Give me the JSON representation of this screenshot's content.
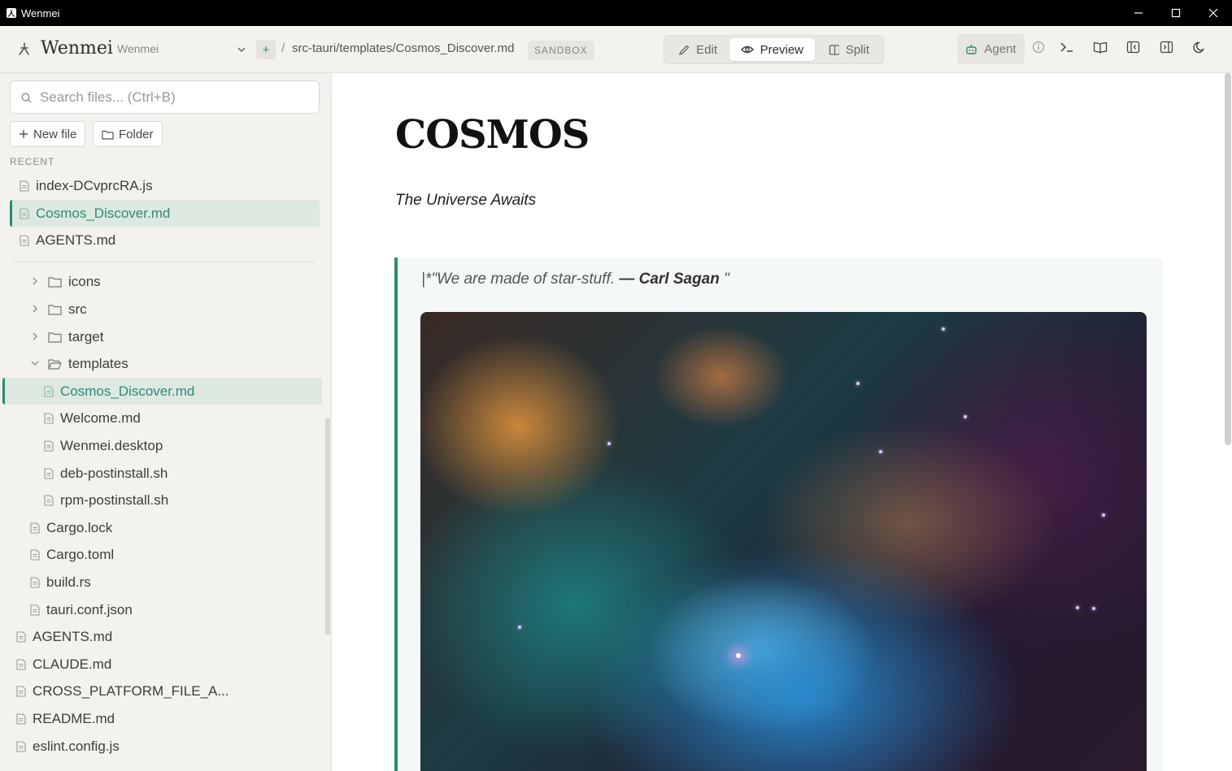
{
  "window": {
    "title": "Wenmei"
  },
  "appbar": {
    "brand": "Wenmei",
    "workspace": "Wenmei",
    "add_label": "+",
    "path_sep": "/",
    "path": "src-tauri/templates/Cosmos_Discover.md",
    "sandbox": "SANDBOX",
    "modes": [
      {
        "label": "Edit"
      },
      {
        "label": "Preview"
      },
      {
        "label": "Split"
      }
    ],
    "active_mode": "Preview",
    "agent": "Agent"
  },
  "sidebar": {
    "search_placeholder": "Search files... (Ctrl+B)",
    "new_file": "New file",
    "folder": "Folder",
    "recent_label": "RECENT",
    "recent": [
      "index-DCvprcRA.js",
      "Cosmos_Discover.md",
      "AGENTS.md"
    ],
    "tree": [
      "icons",
      "src",
      "target",
      "templates",
      "Cosmos_Discover.md",
      "Welcome.md",
      "Wenmei.desktop",
      "deb-postinstall.sh",
      "rpm-postinstall.sh",
      "Cargo.lock",
      "Cargo.toml",
      "build.rs",
      "tauri.conf.json",
      "AGENTS.md",
      "CLAUDE.md",
      "CROSS_PLATFORM_FILE_A...",
      "README.md",
      "eslint.config.js"
    ]
  },
  "document": {
    "title": "COSMOS",
    "subtitle": "The Universe Awaits",
    "quote_prefix": "|*\"We are made of star-stuff. ",
    "quote_author": "— Carl Sagan",
    "quote_suffix": " \""
  },
  "colors": {
    "accent": "#2d8b6f",
    "sidebar_bg": "#f3f2ef",
    "titlebar": "#000000"
  }
}
